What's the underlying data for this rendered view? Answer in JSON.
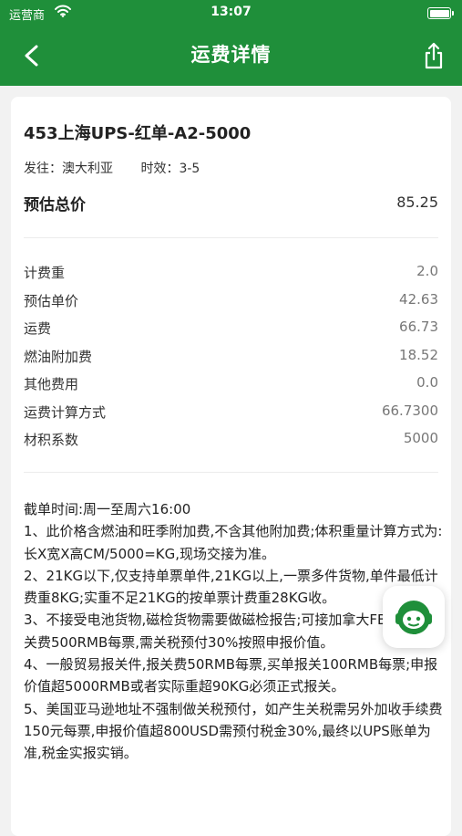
{
  "status_bar": {
    "carrier": "运营商",
    "time": "13:07"
  },
  "nav": {
    "title": "运费详情"
  },
  "detail": {
    "route_name": "453上海UPS-红单-A2-5000",
    "destination": "发往：澳大利亚",
    "transit": "时效：3-5",
    "total_label": "预估总价",
    "total_value": "85.25",
    "fees": [
      {
        "label": "计费重",
        "value": "2.0"
      },
      {
        "label": "预估单价",
        "value": "42.63"
      },
      {
        "label": "运费",
        "value": "66.73"
      },
      {
        "label": "燃油附加费",
        "value": "18.52"
      },
      {
        "label": "其他费用",
        "value": "0.0"
      },
      {
        "label": "运费计算方式",
        "value": "66.7300"
      },
      {
        "label": "材积系数",
        "value": "5000"
      }
    ],
    "notes": "截单时间:周一至周六16:00\n1、此价格含燃油和旺季附加费,不含其他附加费;体积重量计算方式为:长X宽X高CM/5000=KG,现场交接为准。\n2、21KG以下,仅支持单票单件,21KG以上,一票多件货物,单件最低计费重8KG;实重不足21KG的按单票计费重28KG收。\n3、不接受电池货物,磁检货物需要做磁检报告;可接加拿大FBA,另收清关费500RMB每票,需关税预付30%按照申报价值。\n4、一般贸易报关件,报关费50RMB每票,买单报关100RMB每票;申报价值超5000RMB或者实际重超90KG必须正式报关。\n5、美国亚马逊地址不强制做关税预付，如产生关税需另外加收手续费150元每票,申报价值超800USD需预付税金30%,最终以UPS账单为准,税金实报实销。"
  }
}
